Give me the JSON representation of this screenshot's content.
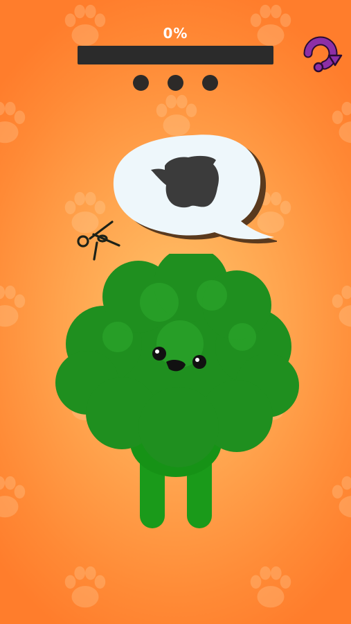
{
  "game": {
    "progress_label": "0%",
    "progress_fraction": 0,
    "stars_total": 3,
    "stars_earned": 0
  },
  "icons": {
    "restart": "restart-icon",
    "scissors": "scissors-icon",
    "speech_bubble": "speech-bubble-icon",
    "paw": "paw-icon"
  },
  "colors": {
    "background": "#ff9a44",
    "progress_track": "#2b2b2b",
    "restart_button": "#8d2fa6",
    "dog_fur": "#1f8f1f",
    "bubble": "#ffffff",
    "silhouette": "#3b3b3b"
  }
}
